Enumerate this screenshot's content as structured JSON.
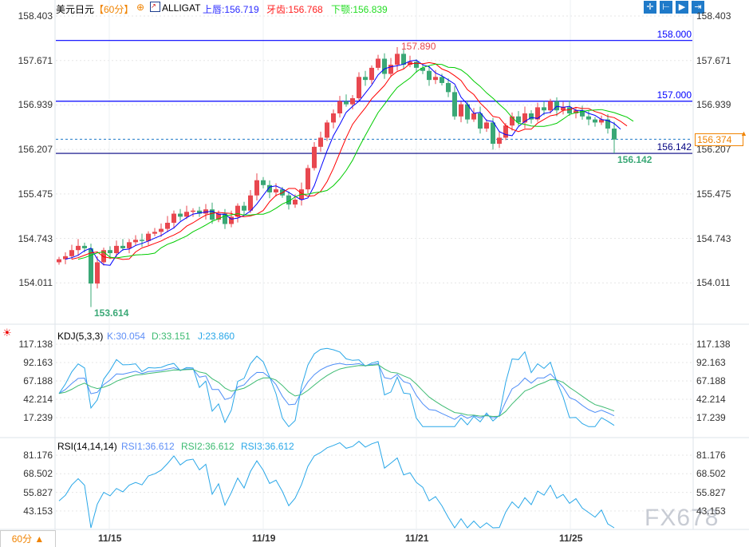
{
  "header": {
    "symbol": "美元日元",
    "period": "【60分】",
    "indicator": "ALLIGAT",
    "lips_label": "上唇:156.719",
    "teeth_label": "牙齿:156.768",
    "jaw_label": "下颚:156.839"
  },
  "toolbar": [
    "crosshair-icon",
    "zoom-range-icon",
    "play-icon",
    "end-icon"
  ],
  "kdj": {
    "label": "KDJ(5,3,3)",
    "k": "K:30.054",
    "d": "D:33.151",
    "j": "J:23.860",
    "ticks": [
      "117.138",
      "92.163",
      "67.188",
      "42.214",
      "17.239"
    ]
  },
  "rsi": {
    "label": "RSI(14,14,14)",
    "r1": "RSI1:36.612",
    "r2": "RSI2:36.612",
    "r3": "RSI3:36.612",
    "ticks": [
      "81.176",
      "68.502",
      "55.827",
      "43.153"
    ]
  },
  "period_button": "60分 ▲",
  "watermark": "FX678",
  "colors": {
    "up": "#e8474f",
    "down": "#3aa876",
    "lips": "#0000ff",
    "teeth": "#ff0000",
    "jaw": "#00cc00",
    "k": "#4f8ef7",
    "d": "#3dbb72",
    "j": "#29a7e8",
    "current": "#f08300"
  },
  "chart_data": {
    "type": "candlestick",
    "price_ticks": [
      "158.403",
      "157.671",
      "156.939",
      "156.207",
      "155.475",
      "154.743",
      "154.011"
    ],
    "ylim": [
      153.5,
      158.403
    ],
    "x_ticks": [
      "11/15",
      "11/19",
      "11/21",
      "11/25"
    ],
    "closes": [
      154.4,
      154.45,
      154.55,
      154.62,
      154.58,
      154.0,
      154.35,
      154.55,
      154.5,
      154.62,
      154.58,
      154.68,
      154.72,
      154.7,
      154.82,
      154.85,
      154.9,
      155.0,
      155.15,
      155.1,
      155.18,
      155.2,
      155.15,
      155.22,
      155.05,
      155.15,
      154.98,
      155.1,
      155.28,
      155.2,
      155.45,
      155.7,
      155.62,
      155.5,
      155.55,
      155.45,
      155.3,
      155.38,
      155.55,
      155.9,
      156.25,
      156.4,
      156.65,
      156.8,
      157.0,
      156.95,
      157.05,
      157.4,
      157.35,
      157.55,
      157.7,
      157.45,
      157.6,
      157.78,
      157.6,
      157.65,
      157.55,
      157.5,
      157.35,
      157.4,
      157.3,
      157.15,
      156.75,
      156.95,
      156.7,
      156.8,
      156.55,
      156.65,
      156.3,
      156.4,
      156.6,
      156.75,
      156.65,
      156.8,
      156.7,
      156.9,
      156.85,
      157.0,
      156.85,
      156.9,
      156.8,
      156.85,
      156.75,
      156.7,
      156.65,
      156.7,
      156.55,
      156.37
    ],
    "high_mark": "157.890",
    "low_mark": "153.614",
    "recent_low_mark": "156.142",
    "lines": [
      {
        "label": "158.000",
        "value": 158.0,
        "color": "#0000ff"
      },
      {
        "label": "157.000",
        "value": 157.0,
        "color": "#0000ff"
      },
      {
        "label": "156.142",
        "value": 156.142,
        "color": "#000080"
      }
    ],
    "current_price": "156.374"
  }
}
